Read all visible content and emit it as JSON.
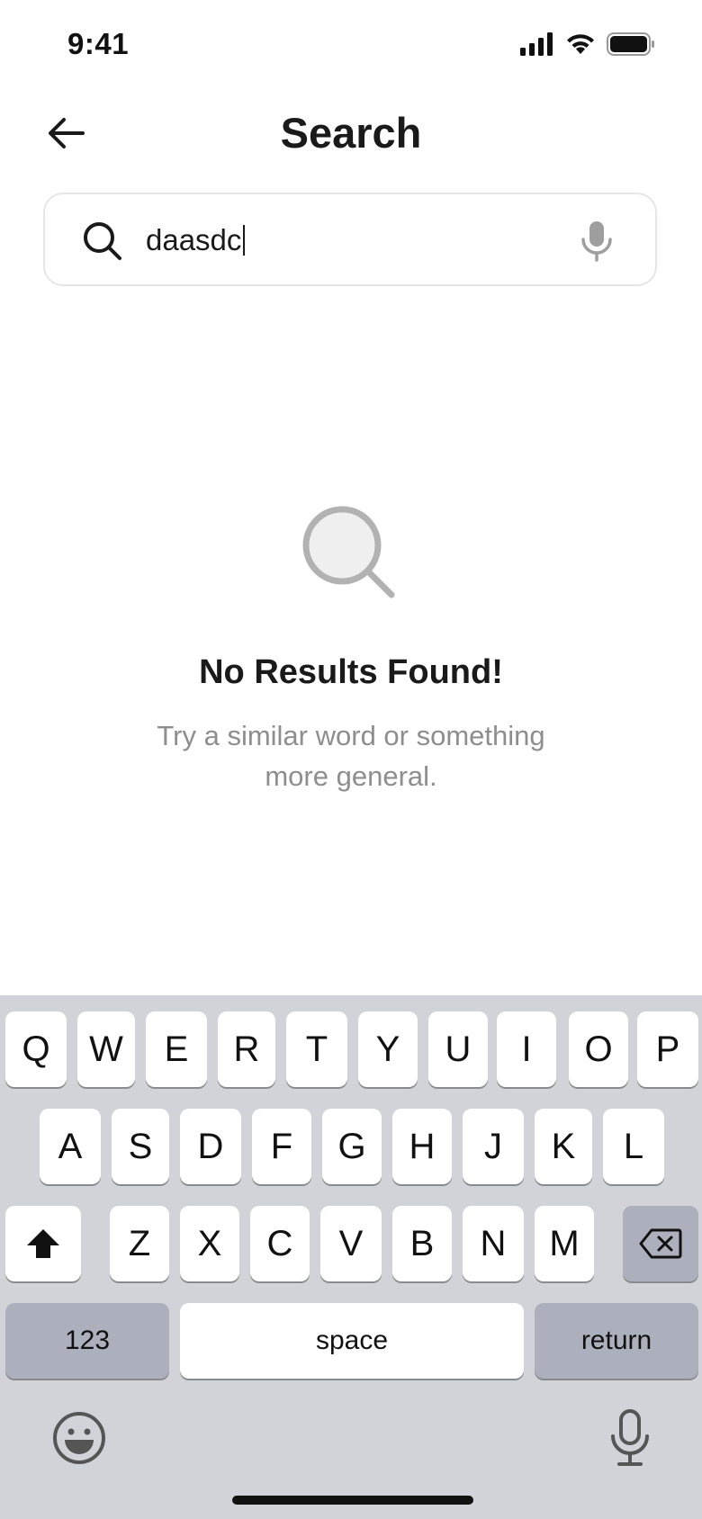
{
  "status_bar": {
    "time": "9:41"
  },
  "header": {
    "title": "Search"
  },
  "search": {
    "value": "daasdc"
  },
  "empty_state": {
    "title": "No Results Found!",
    "subtitle": "Try a similar word or something more general."
  },
  "keyboard": {
    "row1": [
      "Q",
      "W",
      "E",
      "R",
      "T",
      "Y",
      "U",
      "I",
      "O",
      "P"
    ],
    "row2": [
      "A",
      "S",
      "D",
      "F",
      "G",
      "H",
      "J",
      "K",
      "L"
    ],
    "row3": [
      "Z",
      "X",
      "C",
      "V",
      "B",
      "N",
      "M"
    ],
    "numbers_label": "123",
    "space_label": "space",
    "return_label": "return"
  },
  "colors": {
    "text_primary": "#1a1a1a",
    "text_secondary": "#8e8e8e",
    "keyboard_bg": "#d1d3d9",
    "key_dark": "#abb0bc"
  }
}
